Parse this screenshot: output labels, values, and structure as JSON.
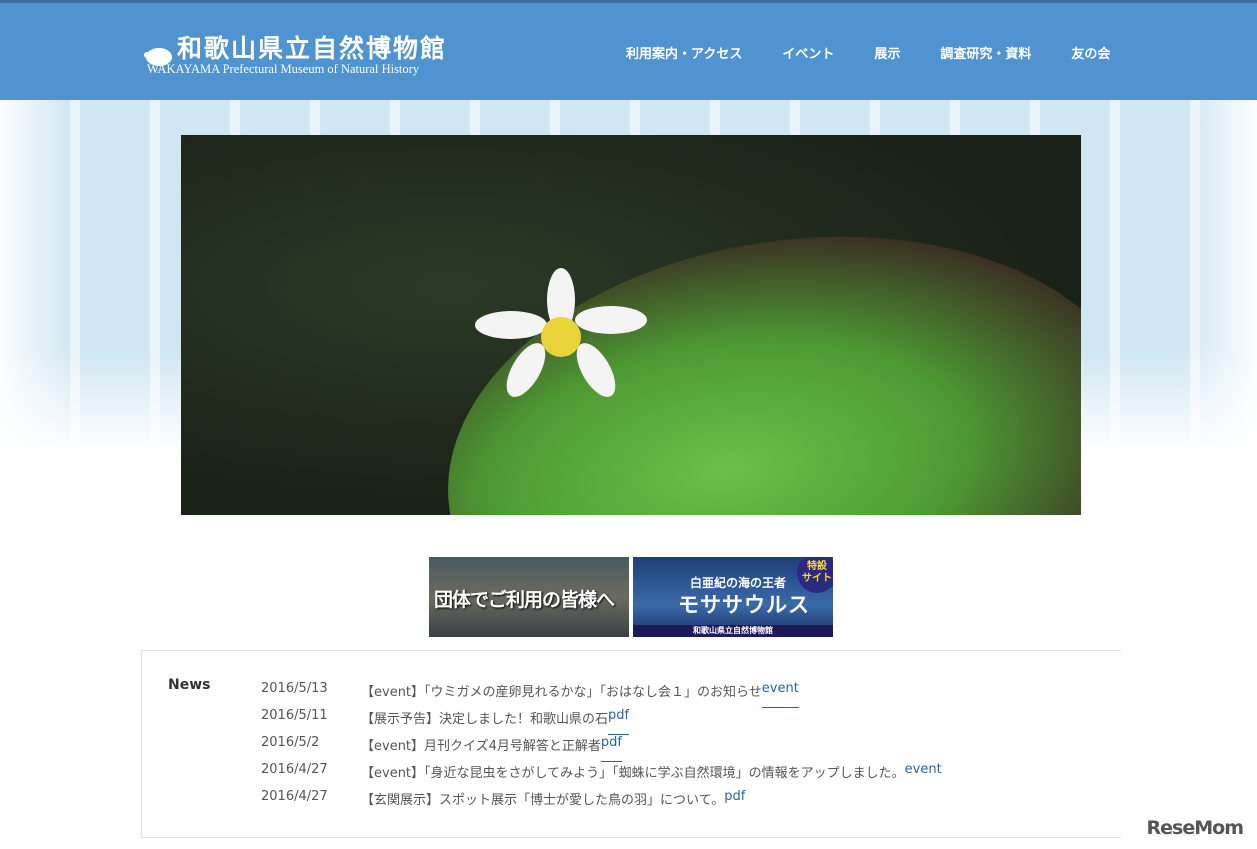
{
  "header": {
    "logo_jp": "和歌山県立自然博物館",
    "logo_en": "WAKAYAMA Prefectural Museum of Natural History",
    "nav": [
      "利用案内・アクセス",
      "イベント",
      "展示",
      "調査研究・資料",
      "友の会"
    ]
  },
  "banners": {
    "group": "団体でご利用の皆様へ",
    "mosa_sub": "白亜紀の海の王者",
    "mosa_title": "モササウルス",
    "mosa_badge1": "特設",
    "mosa_badge2": "サイト",
    "mosa_footer": "和歌山県立自然博物館"
  },
  "news": {
    "title": "News",
    "items": [
      {
        "date": "2016/5/13",
        "text": "【event】「ウミガメの産卵見れるかな」「おはなし会１」のお知らせ",
        "link": "event"
      },
      {
        "date": "2016/5/11",
        "text": "【展示予告】決定しました！和歌山県の石",
        "link": "pdf"
      },
      {
        "date": "2016/5/2",
        "text": "【event】月刊クイズ4月号解答と正解者",
        "link": "pdf"
      },
      {
        "date": "2016/4/27",
        "text": "【event】「身近な昆虫をさがしてみよう」「蜘蛛に学ぶ自然環境」の情報をアップしました。",
        "link": "event"
      },
      {
        "date": "2016/4/27",
        "text": "【玄関展示】スポット展示「博士が愛した鳥の羽」について。",
        "link": "pdf"
      }
    ]
  },
  "watermark": "ReseMom"
}
